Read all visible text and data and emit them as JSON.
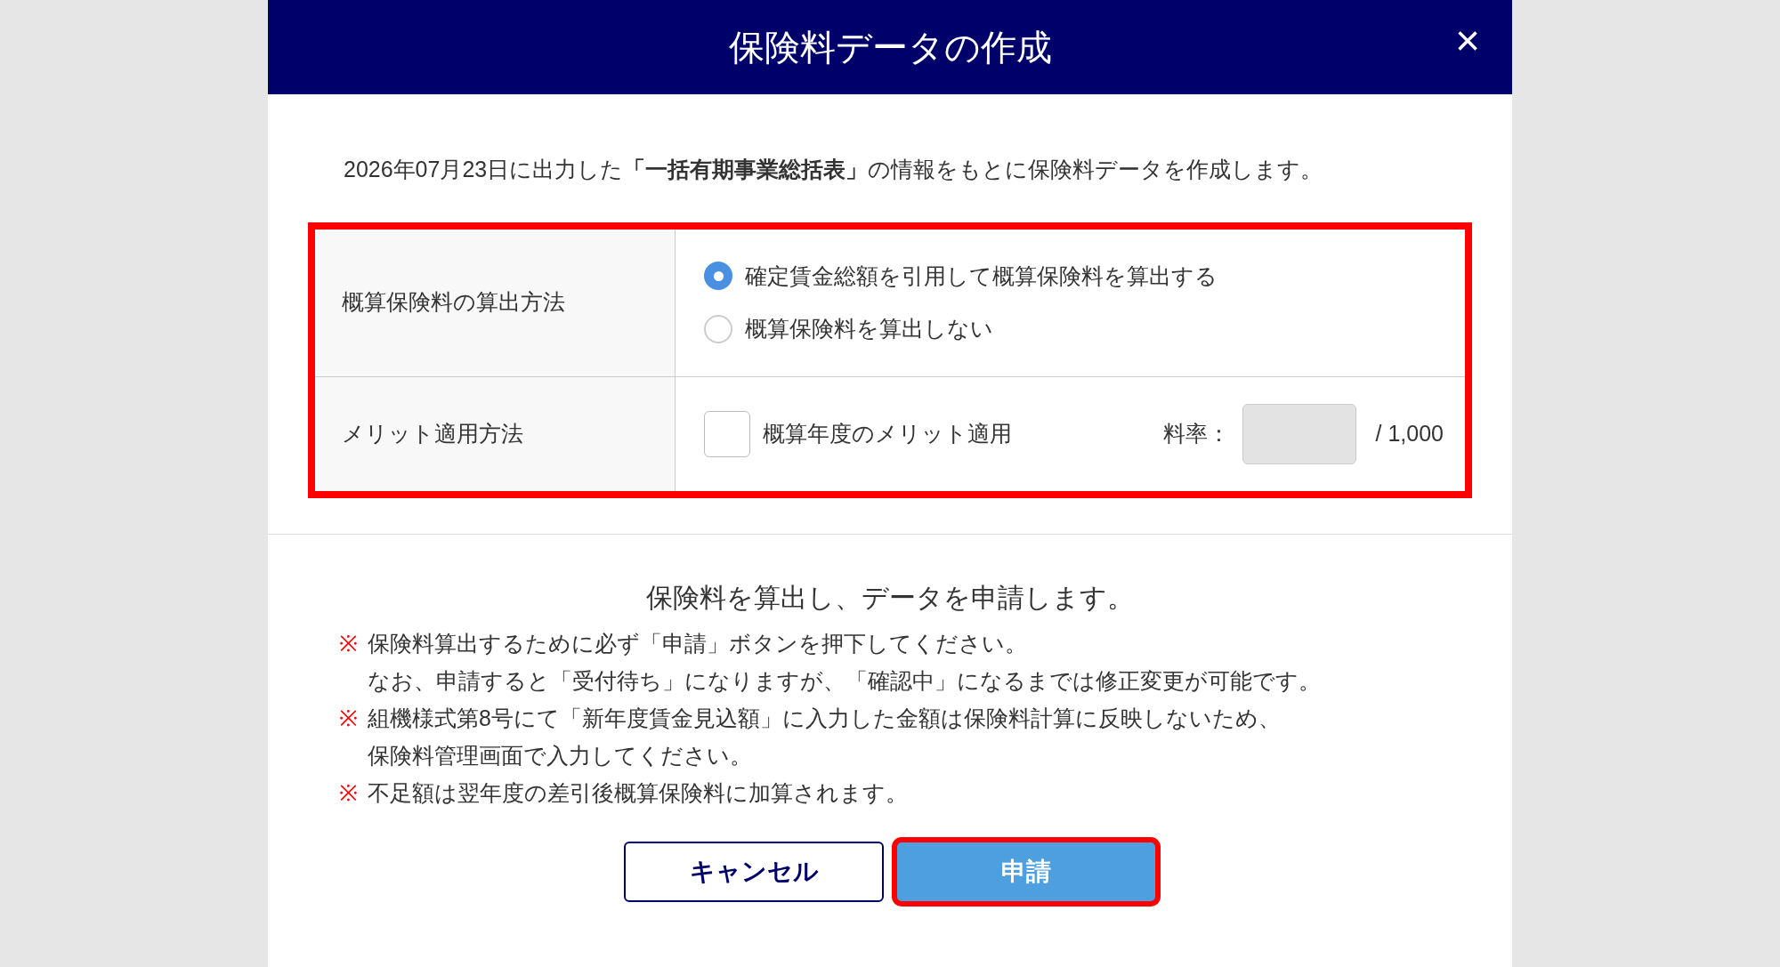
{
  "dialog": {
    "title": "保険料データの作成",
    "close": "×"
  },
  "intro": "2026年07月23日に出力した**「一括有期事業総括表」**の情報をもとに保険料データを作成します。",
  "settings": {
    "highlighted": true,
    "rows": [
      {
        "kind": "radio",
        "label": "概算保険料の算出方法",
        "options": [
          {
            "label": "確定賃金総額を引用して概算保険料を算出する",
            "selected": true
          },
          {
            "label": "概算保険料を算出しない",
            "selected": false
          }
        ]
      },
      {
        "kind": "checkbox",
        "label": "メリット適用方法",
        "checkbox": {
          "label": "概算年度のメリット適用",
          "checked": false
        },
        "rate": {
          "label": "料率：",
          "disabled": true,
          "unit": "/ 1,000"
        }
      }
    ]
  },
  "footer": {
    "heading": "保険料を算出し、データを申請します。",
    "notes": [
      {
        "mark": "※",
        "lines": [
          "保険料算出するために必ず「申請」ボタンを押下してください。",
          "なお、申請すると「受付待ち」になりますが、「確認中」になるまでは修正変更が可能です。"
        ]
      },
      {
        "mark": "※",
        "lines": [
          "組機様式第8号にて「新年度賃金見込額」に入力した金額は保険料計算に反映しないため、",
          "保険料管理画面で入力してください。"
        ]
      },
      {
        "mark": "※",
        "lines": [
          "不足額は翌年度の差引後概算保険料に加算されます。"
        ]
      }
    ],
    "buttons": [
      {
        "kind": "secondary",
        "label": "キャンセル",
        "highlighted": false
      },
      {
        "kind": "primary",
        "label": "申請",
        "highlighted": true
      }
    ]
  }
}
